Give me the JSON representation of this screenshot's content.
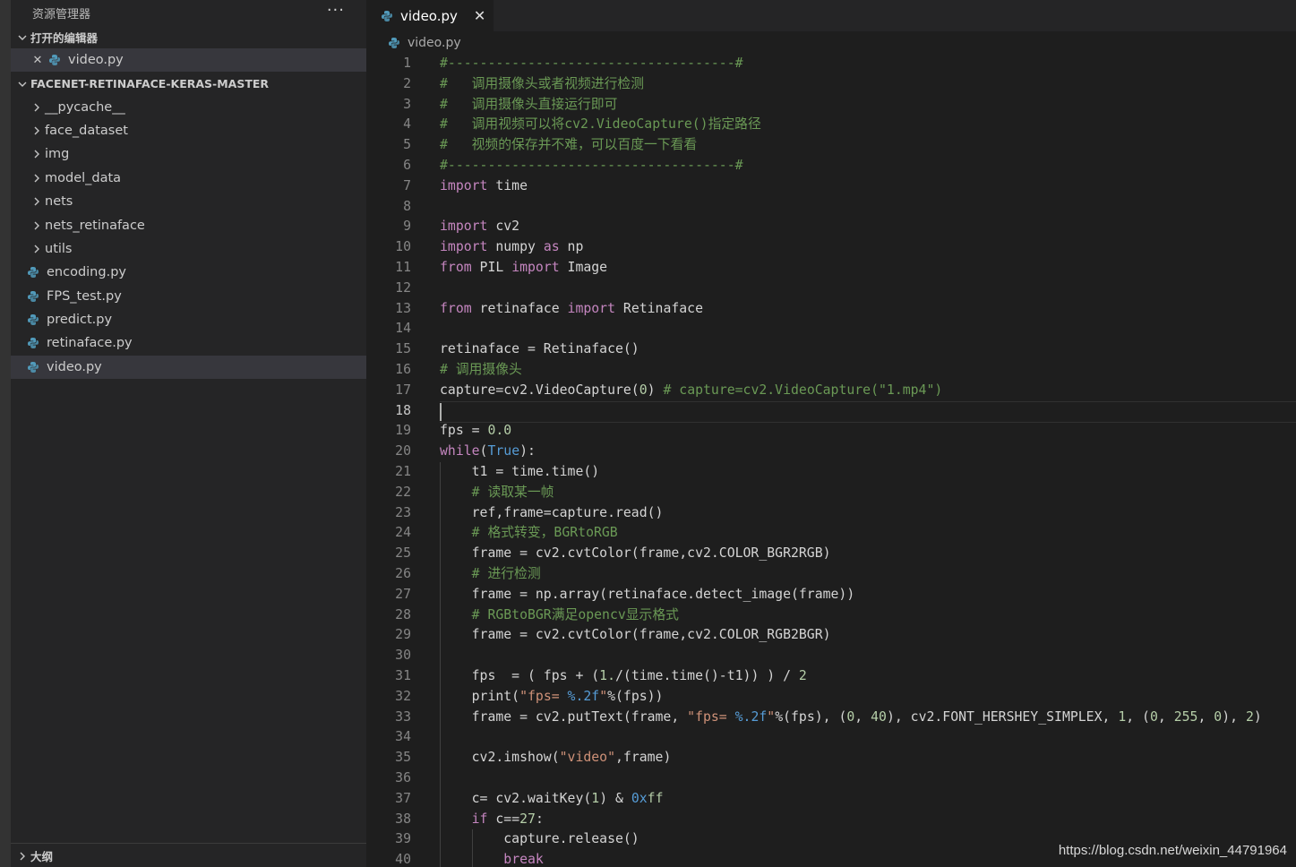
{
  "colors": {
    "keyword": "#c586c0",
    "comment": "#6a9955",
    "string": "#ce9178",
    "number": "#b5cea8",
    "builtin": "#569cd6",
    "plain": "#d4d4d4",
    "python_icon": "#519aba"
  },
  "sidebar": {
    "title": "资源管理器",
    "more": "···",
    "open_editors": {
      "header": "打开的编辑器",
      "items": [
        {
          "label": "video.py",
          "icon": "python-file-icon"
        }
      ]
    },
    "project": {
      "header": "FACENET-RETINAFACE-KERAS-MASTER",
      "folders": [
        "__pycache__",
        "face_dataset",
        "img",
        "model_data",
        "nets",
        "nets_retinaface",
        "utils"
      ],
      "files": [
        "encoding.py",
        "FPS_test.py",
        "predict.py",
        "retinaface.py",
        "video.py"
      ],
      "selected": "video.py"
    },
    "outline": "大纲"
  },
  "tab": {
    "label": "video.py",
    "close": "✕"
  },
  "breadcrumb": "video.py",
  "editor": {
    "current_line": 18,
    "lines": [
      [
        [
          "c",
          "#------------------------------------#"
        ]
      ],
      [
        [
          "c",
          "#   调用摄像头或者视频进行检测"
        ]
      ],
      [
        [
          "c",
          "#   调用摄像头直接运行即可"
        ]
      ],
      [
        [
          "c",
          "#   调用视频可以将cv2.VideoCapture()指定路径"
        ]
      ],
      [
        [
          "c",
          "#   视频的保存并不难，可以百度一下看看"
        ]
      ],
      [
        [
          "c",
          "#------------------------------------#"
        ]
      ],
      [
        [
          "k",
          "import"
        ],
        [
          "p",
          " time"
        ]
      ],
      [],
      [
        [
          "k",
          "import"
        ],
        [
          "p",
          " cv2"
        ]
      ],
      [
        [
          "k",
          "import"
        ],
        [
          "p",
          " numpy "
        ],
        [
          "k",
          "as"
        ],
        [
          "p",
          " np"
        ]
      ],
      [
        [
          "k",
          "from"
        ],
        [
          "p",
          " PIL "
        ],
        [
          "k",
          "import"
        ],
        [
          "p",
          " Image"
        ]
      ],
      [],
      [
        [
          "k",
          "from"
        ],
        [
          "p",
          " retinaface "
        ],
        [
          "k",
          "import"
        ],
        [
          "p",
          " Retinaface"
        ]
      ],
      [],
      [
        [
          "p",
          "retinaface = Retinaface()"
        ]
      ],
      [
        [
          "c",
          "# 调用摄像头"
        ]
      ],
      [
        [
          "p",
          "capture=cv2.VideoCapture("
        ],
        [
          "n",
          "0"
        ],
        [
          "p",
          ") "
        ],
        [
          "c",
          "# capture=cv2.VideoCapture(\"1.mp4\")"
        ]
      ],
      [],
      [
        [
          "p",
          "fps = "
        ],
        [
          "n",
          "0.0"
        ]
      ],
      [
        [
          "k",
          "while"
        ],
        [
          "p",
          "("
        ],
        [
          "b",
          "True"
        ],
        [
          "p",
          "):"
        ]
      ],
      [
        [
          "p",
          "    t1 = time.time()"
        ]
      ],
      [
        [
          "c",
          "    # 读取某一帧"
        ]
      ],
      [
        [
          "p",
          "    ref,frame=capture.read()"
        ]
      ],
      [
        [
          "c",
          "    # 格式转变，BGRtoRGB"
        ]
      ],
      [
        [
          "p",
          "    frame = cv2.cvtColor(frame,cv2.COLOR_BGR2RGB)"
        ]
      ],
      [
        [
          "c",
          "    # 进行检测"
        ]
      ],
      [
        [
          "p",
          "    frame = np.array(retinaface.detect_image(frame))"
        ]
      ],
      [
        [
          "c",
          "    # RGBtoBGR满足opencv显示格式"
        ]
      ],
      [
        [
          "p",
          "    frame = cv2.cvtColor(frame,cv2.COLOR_RGB2BGR)"
        ]
      ],
      [],
      [
        [
          "p",
          "    fps  = ( fps + ("
        ],
        [
          "n",
          "1."
        ],
        [
          "p",
          "/(time.time()-t1)) ) / "
        ],
        [
          "n",
          "2"
        ]
      ],
      [
        [
          "p",
          "    print("
        ],
        [
          "s",
          "\"fps= "
        ],
        [
          "b",
          "%.2f"
        ],
        [
          "s",
          "\""
        ],
        [
          "p",
          "%(fps))"
        ]
      ],
      [
        [
          "p",
          "    frame = cv2.putText(frame, "
        ],
        [
          "s",
          "\"fps= "
        ],
        [
          "b",
          "%.2f"
        ],
        [
          "s",
          "\""
        ],
        [
          "p",
          "%(fps), ("
        ],
        [
          "n",
          "0"
        ],
        [
          "p",
          ", "
        ],
        [
          "n",
          "40"
        ],
        [
          "p",
          "), cv2.FONT_HERSHEY_SIMPLEX, "
        ],
        [
          "n",
          "1"
        ],
        [
          "p",
          ", ("
        ],
        [
          "n",
          "0"
        ],
        [
          "p",
          ", "
        ],
        [
          "n",
          "255"
        ],
        [
          "p",
          ", "
        ],
        [
          "n",
          "0"
        ],
        [
          "p",
          "), "
        ],
        [
          "n",
          "2"
        ],
        [
          "p",
          ")"
        ]
      ],
      [],
      [
        [
          "p",
          "    cv2.imshow("
        ],
        [
          "s",
          "\"video\""
        ],
        [
          "p",
          ",frame)"
        ]
      ],
      [],
      [
        [
          "p",
          "    c= cv2.waitKey("
        ],
        [
          "n",
          "1"
        ],
        [
          "p",
          ") & "
        ],
        [
          "b",
          "0x"
        ],
        [
          "n",
          "ff"
        ]
      ],
      [
        [
          "p",
          "    "
        ],
        [
          "k",
          "if"
        ],
        [
          "p",
          " c=="
        ],
        [
          "n",
          "27"
        ],
        [
          "p",
          ":"
        ]
      ],
      [
        [
          "p",
          "        capture.release()"
        ]
      ],
      [
        [
          "p",
          "        "
        ],
        [
          "k",
          "break"
        ]
      ]
    ]
  },
  "watermark": "https://blog.csdn.net/weixin_44791964"
}
